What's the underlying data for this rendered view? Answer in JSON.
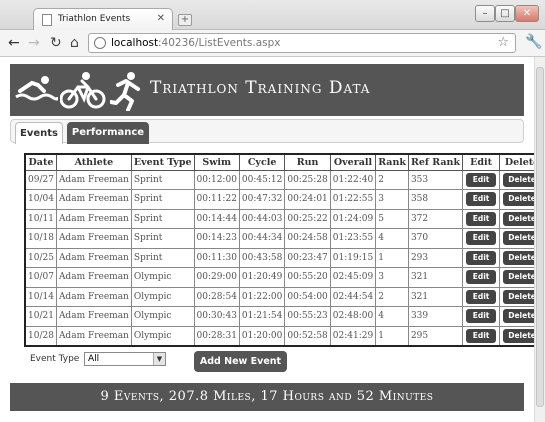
{
  "browser": {
    "tab_title": "Triathlon Events",
    "url_host": "localhost",
    "url_path": ":40236/ListEvents.aspx"
  },
  "header": {
    "title": "Triathlon Training Data"
  },
  "tabs": [
    {
      "label": "Events",
      "active": true
    },
    {
      "label": "Performance",
      "active": false
    }
  ],
  "table": {
    "columns": [
      "Date",
      "Athlete",
      "Event Type",
      "Swim",
      "Cycle",
      "Run",
      "Overall",
      "Rank",
      "Ref Rank",
      "Edit",
      "Delete"
    ],
    "edit_label": "Edit",
    "delete_label": "Delete",
    "rows": [
      [
        "09/27",
        "Adam Freeman",
        "Sprint",
        "00:12:00",
        "00:45:12",
        "00:25:28",
        "01:22:40",
        "2",
        "353"
      ],
      [
        "10/04",
        "Adam Freeman",
        "Sprint",
        "00:11:22",
        "00:47:32",
        "00:24:01",
        "01:22:55",
        "3",
        "358"
      ],
      [
        "10/11",
        "Adam Freeman",
        "Sprint",
        "00:14:44",
        "00:44:03",
        "00:25:22",
        "01:24:09",
        "5",
        "372"
      ],
      [
        "10/18",
        "Adam Freeman",
        "Sprint",
        "00:14:23",
        "00:44:34",
        "00:24:58",
        "01:23:55",
        "4",
        "370"
      ],
      [
        "10/25",
        "Adam Freeman",
        "Sprint",
        "00:11:30",
        "00:43:58",
        "00:23:47",
        "01:19:15",
        "1",
        "293"
      ],
      [
        "10/07",
        "Adam Freeman",
        "Olympic",
        "00:29:00",
        "01:20:49",
        "00:55:20",
        "02:45:09",
        "3",
        "321"
      ],
      [
        "10/14",
        "Adam Freeman",
        "Olympic",
        "00:28:54",
        "01:22:00",
        "00:54:00",
        "02:44:54",
        "2",
        "321"
      ],
      [
        "10/21",
        "Adam Freeman",
        "Olympic",
        "00:30:43",
        "01:21:54",
        "00:55:23",
        "02:48:00",
        "4",
        "339"
      ],
      [
        "10/28",
        "Adam Freeman",
        "Olympic",
        "00:28:31",
        "01:20:00",
        "00:52:58",
        "02:41:29",
        "1",
        "295"
      ]
    ]
  },
  "filter": {
    "label": "Event Type",
    "selected": "All"
  },
  "add_button_label": "Add New Event",
  "summary": "9 Events, 207.8 Miles, 17 Hours and 52 Minutes",
  "colors": {
    "banner": "#555555",
    "button": "#444444"
  }
}
